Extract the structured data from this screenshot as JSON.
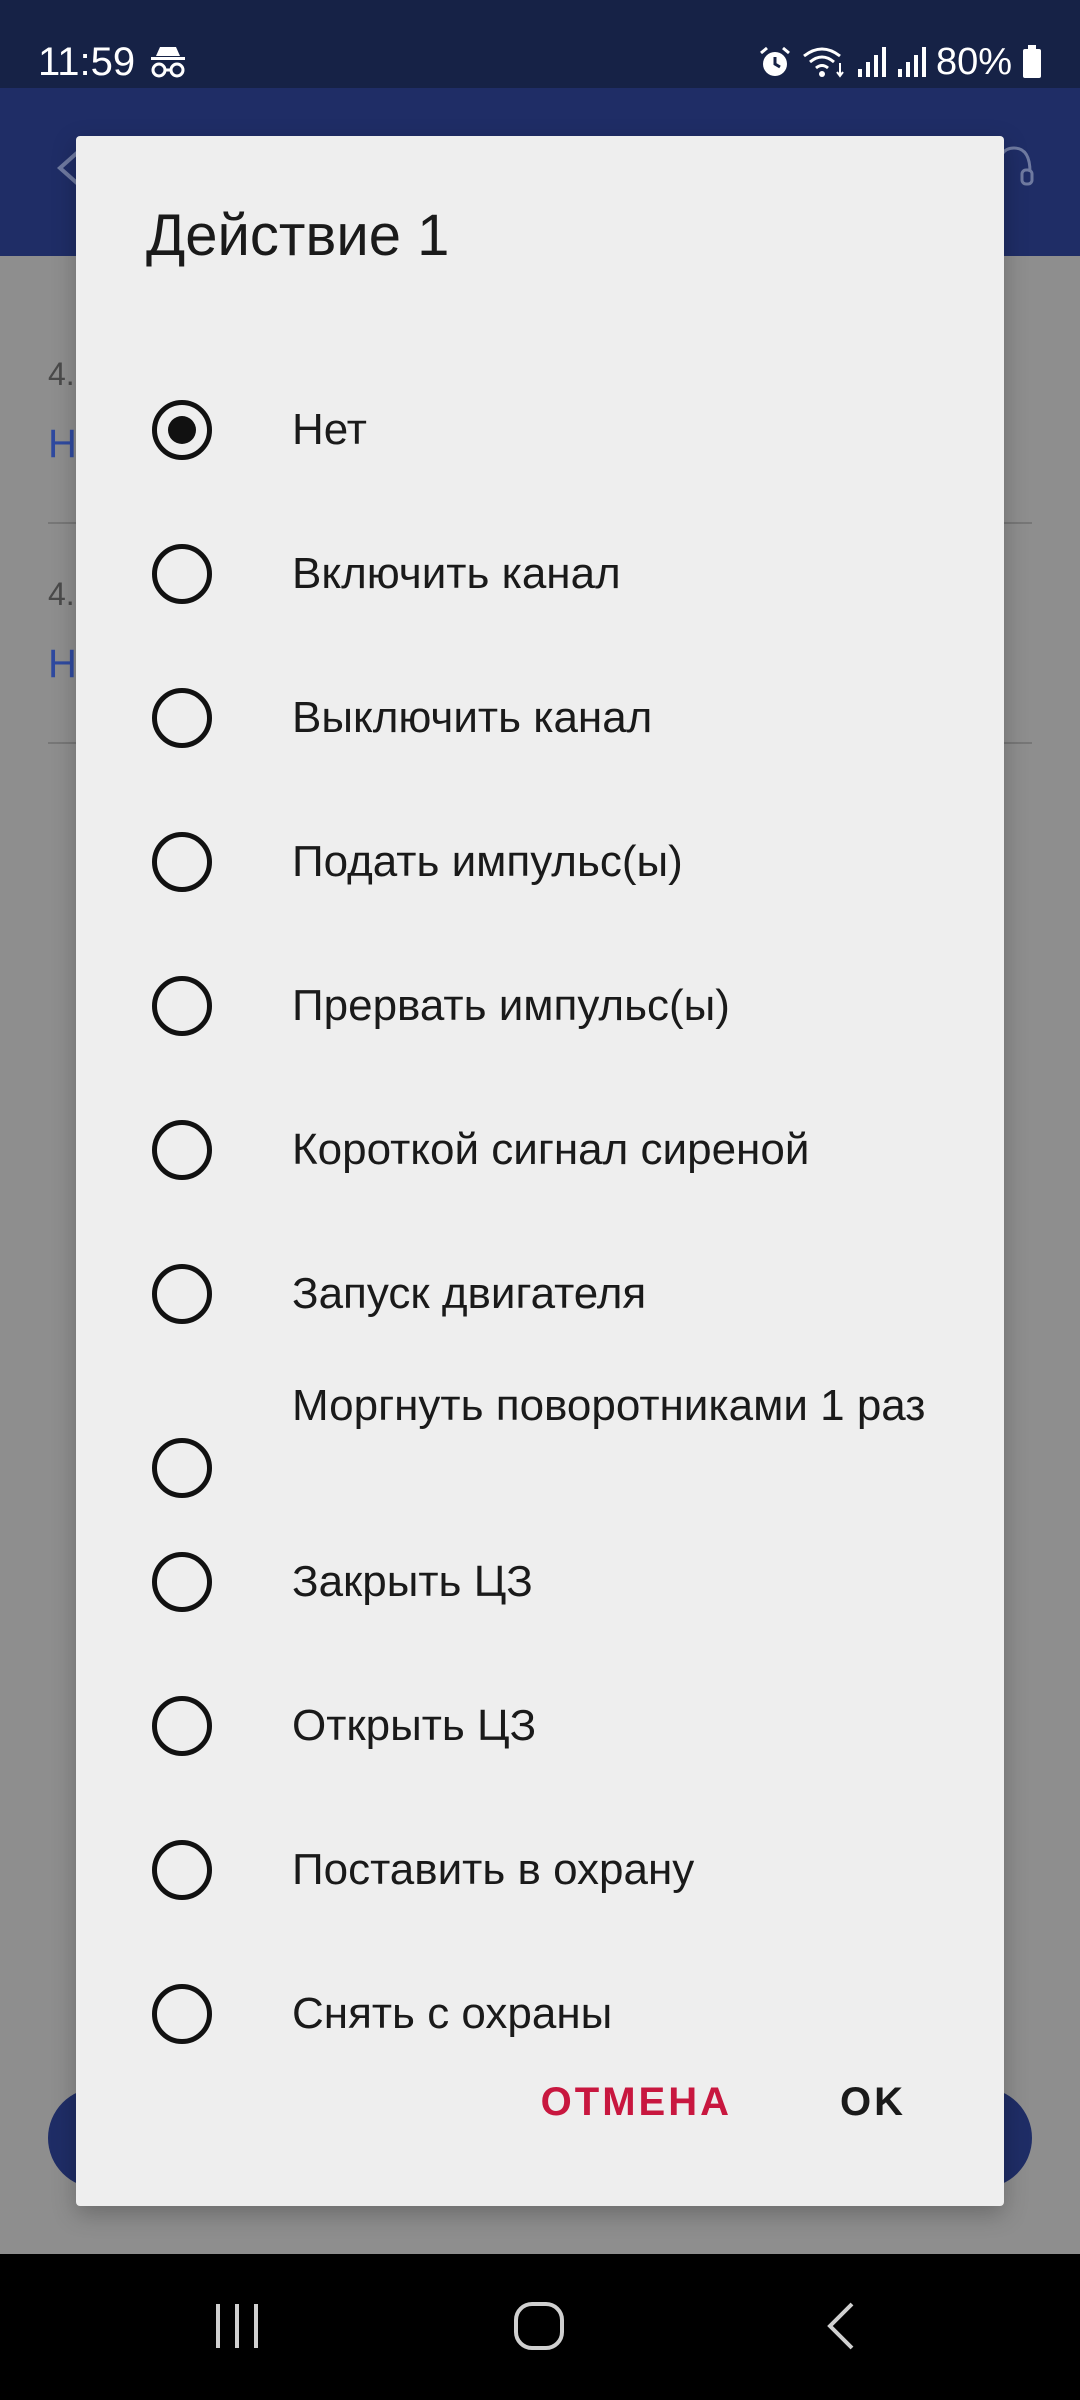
{
  "status_bar": {
    "time": "11:59",
    "battery": "80%",
    "icons": [
      "incognito-icon",
      "alarm-icon",
      "wifi-icon",
      "signal-icon",
      "signal-icon",
      "battery-icon"
    ]
  },
  "background_app": {
    "rows": [
      {
        "num": "4.",
        "value": "Н"
      },
      {
        "num": "4.",
        "value": "Н"
      }
    ],
    "colors": {
      "app_bar": "#1f2d66",
      "accent": "#2f4aa0"
    }
  },
  "dialog": {
    "title": "Действие 1",
    "options": [
      {
        "label": "Нет",
        "checked": true
      },
      {
        "label": "Включить канал",
        "checked": false
      },
      {
        "label": "Выключить канал",
        "checked": false
      },
      {
        "label": "Подать импульс(ы)",
        "checked": false
      },
      {
        "label": "Прервать импульс(ы)",
        "checked": false
      },
      {
        "label": "Короткой сигнал сиреной",
        "checked": false
      },
      {
        "label": "Запуск двигателя",
        "checked": false
      },
      {
        "label": "Моргнуть поворотниками 1 раз",
        "checked": false
      },
      {
        "label": "Закрыть ЦЗ",
        "checked": false
      },
      {
        "label": "Открыть ЦЗ",
        "checked": false
      },
      {
        "label": "Поставить в охрану",
        "checked": false
      },
      {
        "label": "Снять с охраны",
        "checked": false
      }
    ],
    "cancel_label": "ОТМЕНА",
    "ok_label": "OK",
    "colors": {
      "cancel": "#c8173f",
      "background": "#eeeeee"
    }
  },
  "nav_bar": {
    "icons": [
      "recents-icon",
      "home-icon",
      "back-icon"
    ]
  }
}
